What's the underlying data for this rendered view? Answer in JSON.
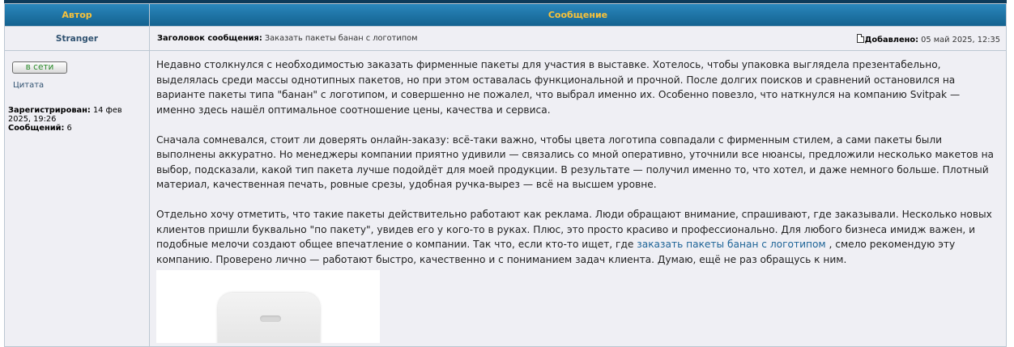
{
  "header": {
    "author_col": "Автор",
    "message_col": "Сообщение"
  },
  "post": {
    "author": "Stranger",
    "subject_label": "Заголовок сообщения:",
    "subject": "Заказать пакеты банан с логотипом",
    "posted_label": "Добавлено:",
    "posted_date": "05 май 2025, 12:35",
    "online_badge": "в сети",
    "quote_link": "Цитата",
    "registered_label": "Зарегистрирован:",
    "registered_date": "14 фев 2025, 19:26",
    "posts_label": "Сообщений:",
    "posts_count": "6",
    "paragraphs": [
      "Недавно столкнулся с необходимостью заказать фирменные пакеты для участия в выставке. Хотелось, чтобы упаковка выглядела презентабельно, выделялась среди массы однотипных пакетов, но при этом оставалась функциональной и прочной. После долгих поисков и сравнений остановился на варианте пакеты типа \"банан\" с логотипом, и совершенно не пожалел, что выбрал именно их. Особенно повезло, что наткнулся на компанию Svitpak — именно здесь нашёл оптимальное соотношение цены, качества и сервиса.",
      "Сначала сомневался, стоит ли доверять онлайн-заказу: всё-таки важно, чтобы цвета логотипа совпадали с фирменным стилем, а сами пакеты были выполнены аккуратно. Но менеджеры компании приятно удивили — связались со мной оперативно, уточнили все нюансы, предложили несколько макетов на выбор, подсказали, какой тип пакета лучше подойдёт для моей продукции. В результате — получил именно то, что хотел, и даже немного больше. Плотный материал, качественная печать, ровные срезы, удобная ручка-вырез — всё на высшем уровне."
    ],
    "p3_before": "Отдельно хочу отметить, что такие пакеты действительно работают как реклама. Люди обращают внимание, спрашивают, где заказывали. Несколько новых клиентов пришли буквально \"по пакету\", увидев его у кого-то в руках. Плюс, это просто красиво и профессионально. Для любого бизнеса имидж важен, и подобные мелочи создают общее впечатление о компании. Так что, если кто-то ищет, где",
    "p3_link": "заказать пакеты банан с логотипом",
    "p3_after": ", смело рекомендую эту компанию. Проверено лично — работают быстро, качественно и с пониманием задач клиента. Думаю, ещё не раз обращусь к ним."
  }
}
